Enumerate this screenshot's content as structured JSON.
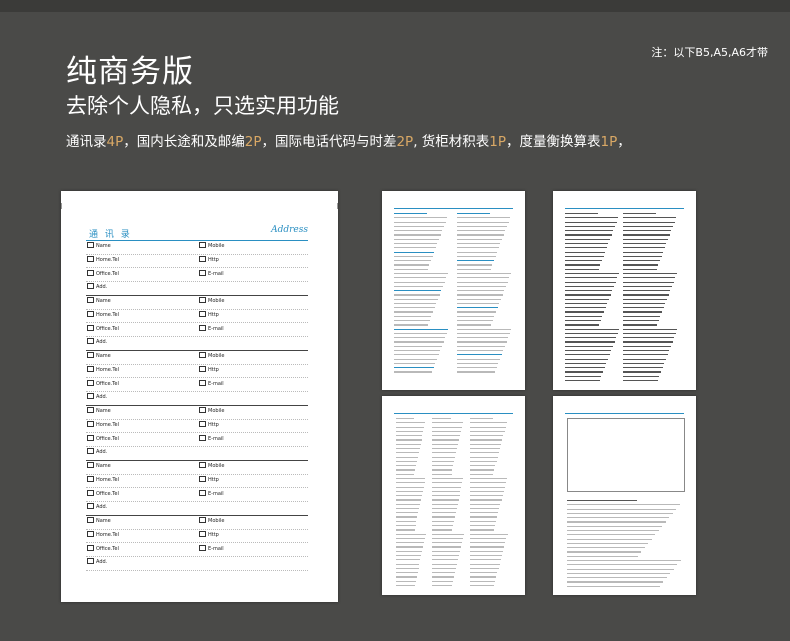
{
  "header": {
    "note": "注：以下B5,A5,A6才带",
    "title": "纯商务版",
    "subtitle": "去除个人隐私，只选实用功能",
    "desc": [
      {
        "t": "通讯录",
        "hl": false
      },
      {
        "t": "4P",
        "hl": true
      },
      {
        "t": "，国内长途和及邮编",
        "hl": false
      },
      {
        "t": "2P",
        "hl": true
      },
      {
        "t": "，国际电话代码与时差",
        "hl": false
      },
      {
        "t": "2P",
        "hl": true
      },
      {
        "t": ", 货柜材积表",
        "hl": false
      },
      {
        "t": "1P",
        "hl": true
      },
      {
        "t": "，度量衡换算表",
        "hl": false
      },
      {
        "t": "1P",
        "hl": true
      },
      {
        "t": "，",
        "hl": false
      }
    ]
  },
  "address_page": {
    "title_cn": "通 讯 录",
    "title_en": "Address",
    "fields": {
      "name": "Name",
      "mobile": "Mobile",
      "home_tel": "Home.Tel",
      "http": "Http",
      "office_tel": "Office.Tel",
      "email": "E-mail",
      "add": "Add."
    },
    "icons": {
      "name": "person-icon",
      "mobile": "mobile-phone-icon",
      "home_tel": "phone-icon",
      "http": "monitor-icon",
      "office_tel": "fax-icon",
      "email": "envelope-icon",
      "add": "envelope-icon"
    }
  },
  "mini_pages": [
    {
      "title": "国内长途区号及邮编",
      "title_en": "Area Codes & Postal Code"
    },
    {
      "title": "国际电话代码与时差",
      "title_en": "IDD CODES & TIME DIFFERENCES"
    },
    {
      "title": "度量衡换算表",
      "title_en": "METRIC CONVERSIONS"
    },
    {
      "title": "货柜材积表",
      "title_en": "CONTAINER SPECIFICATIONS"
    }
  ],
  "colors": {
    "background": "#4a4a48",
    "accent": "#d9a865",
    "blue": "#2a8fc2"
  }
}
